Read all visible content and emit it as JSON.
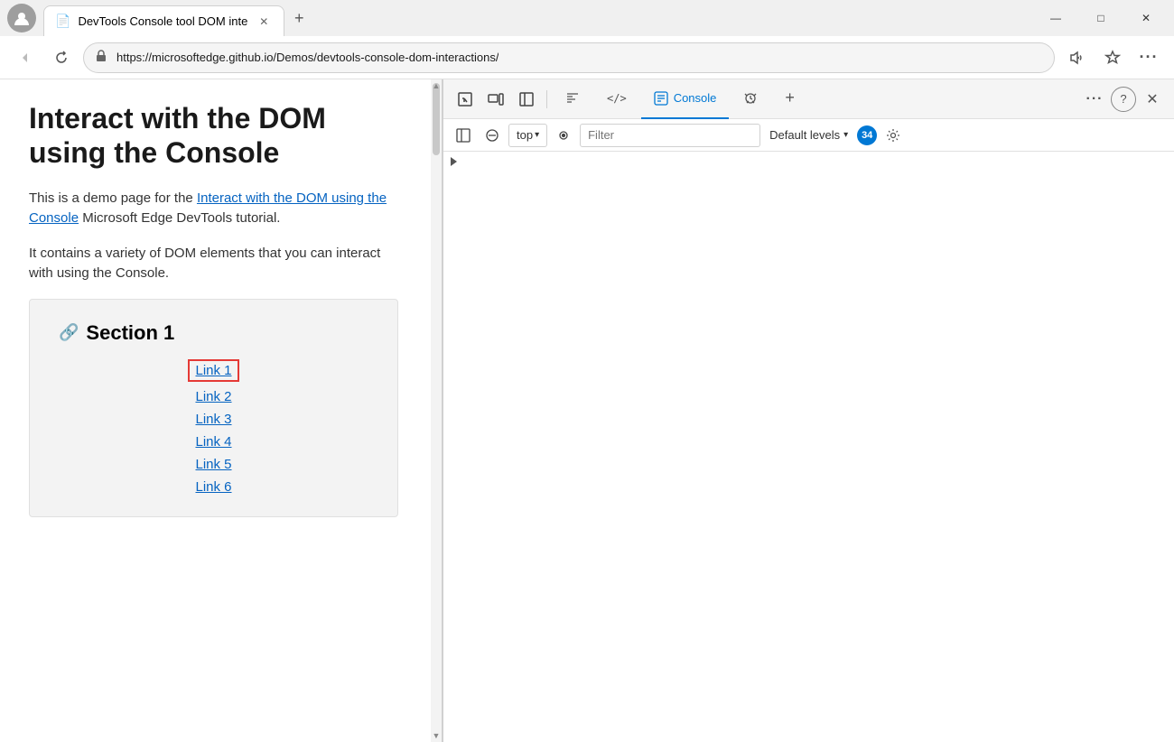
{
  "window": {
    "title": "DevTools Console tool DOM inte",
    "url": "https://microsoftedge.github.io/Demos/devtools-console-dom-interactions/",
    "tab_icon": "📄"
  },
  "browser": {
    "back_btn": "←",
    "refresh_btn": "↻",
    "lock_icon": "🔒",
    "address_url": "https://microsoftedge.github.io/Demos/devtools-console-dom-interactions/",
    "read_aloud_icon": "🔊",
    "favorites_icon": "☆",
    "more_icon": "···"
  },
  "window_controls": {
    "minimize": "—",
    "maximize": "□",
    "close": "✕"
  },
  "webpage": {
    "heading": "Interact with the DOM using the Console",
    "para1_pre": "This is a demo page for the ",
    "para1_link": "Interact with the DOM using the Console",
    "para1_post": " Microsoft Edge DevTools tutorial.",
    "para2": "It contains a variety of DOM elements that you can interact with using the Console.",
    "section1": {
      "title": "Section 1",
      "link_icon": "🔗",
      "links": [
        "Link 1",
        "Link 2",
        "Link 3",
        "Link 4",
        "Link 5",
        "Link 6"
      ]
    }
  },
  "devtools": {
    "toolbar": {
      "inspect_icon": "⬚",
      "device_icon": "⬜",
      "sidebar_icon": "▣",
      "tabs": [
        {
          "id": "elements",
          "icon": "⌂",
          "label": ""
        },
        {
          "id": "code",
          "icon": "</>",
          "label": ""
        },
        {
          "id": "console",
          "icon": "▦",
          "label": "Console",
          "active": true
        },
        {
          "id": "debug",
          "icon": "⚙",
          "label": ""
        }
      ],
      "plus_icon": "+",
      "more_icon": "···",
      "help_icon": "?",
      "close_icon": "✕"
    },
    "console_toolbar": {
      "sidebar_icon": "▶",
      "clear_icon": "⊘",
      "context_label": "top",
      "dropdown_icon": "▾",
      "eye_icon": "◉",
      "filter_placeholder": "Filter",
      "default_levels": "Default levels",
      "levels_dropdown": "▾",
      "message_count": "34",
      "settings_icon": "⚙"
    },
    "console_output": {
      "expand_icon": "▶"
    }
  },
  "colors": {
    "active_tab_blue": "#0078d4",
    "link_blue": "#0563c1",
    "badge_blue": "#0078d4",
    "highlight_red": "#e53935"
  }
}
